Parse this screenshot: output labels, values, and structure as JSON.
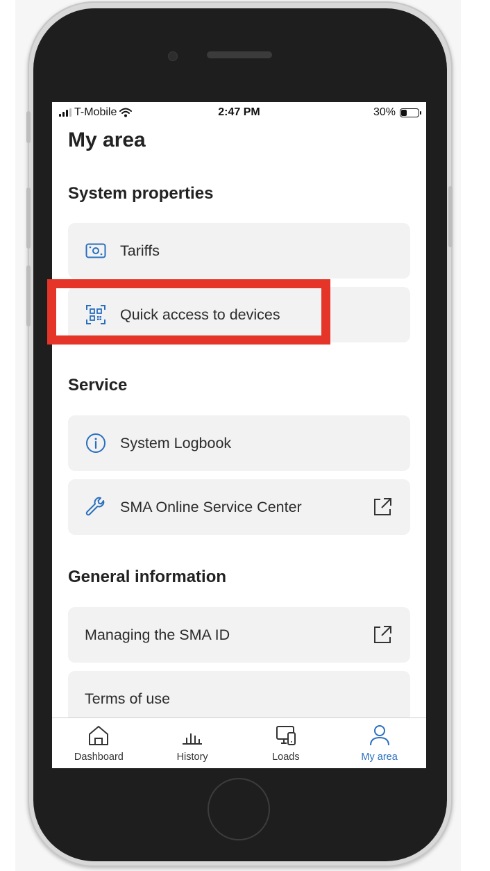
{
  "status_bar": {
    "carrier": "T-Mobile",
    "time": "2:47 PM",
    "battery": "30%",
    "battery_level": 0.3
  },
  "page": {
    "title": "My area"
  },
  "sections": {
    "system_properties": {
      "heading": "System properties",
      "items": [
        {
          "label": "Tariffs",
          "icon": "tariff-money-icon"
        },
        {
          "label": "Quick access to devices",
          "icon": "qr-code-icon"
        }
      ]
    },
    "service": {
      "heading": "Service",
      "items": [
        {
          "label": "System Logbook",
          "icon": "info-icon"
        },
        {
          "label": "SMA Online Service Center",
          "icon": "wrench-icon",
          "external": true
        }
      ]
    },
    "general_information": {
      "heading": "General information",
      "items": [
        {
          "label": "Managing the SMA ID",
          "external": true
        },
        {
          "label": "Terms of use"
        }
      ]
    }
  },
  "bottom_nav": [
    {
      "label": "Dashboard",
      "icon": "home-icon"
    },
    {
      "label": "History",
      "icon": "bar-chart-icon"
    },
    {
      "label": "Loads",
      "icon": "devices-icon"
    },
    {
      "label": "My area",
      "icon": "person-icon",
      "active": true
    }
  ],
  "colors": {
    "accent": "#2a6fbe",
    "highlight": "#e53528",
    "card_bg": "#f2f2f2"
  }
}
